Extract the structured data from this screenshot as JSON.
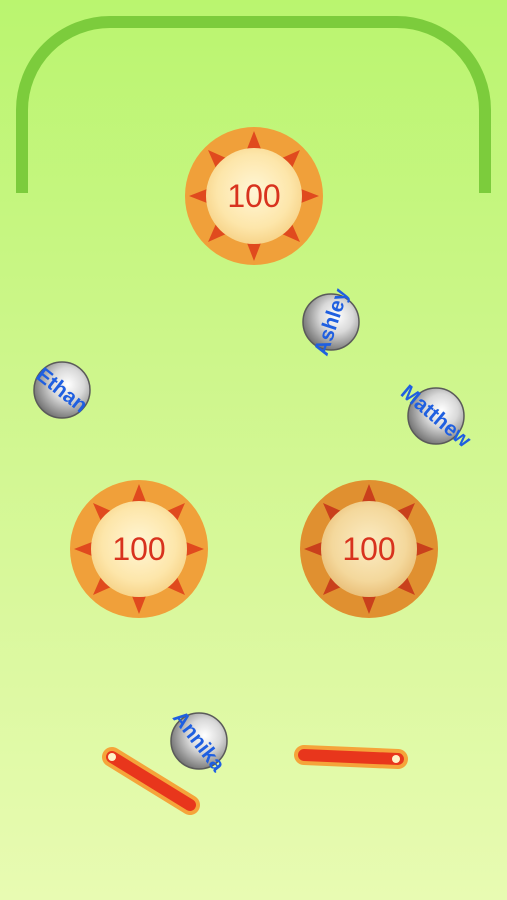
{
  "bumpers": [
    {
      "id": "top",
      "score": "100"
    },
    {
      "id": "left",
      "score": "100"
    },
    {
      "id": "right",
      "score": "100"
    }
  ],
  "balls": [
    {
      "id": "ashley",
      "name": "Ashley"
    },
    {
      "id": "ethan",
      "name": "Ethan"
    },
    {
      "id": "matthew",
      "name": "Matthew"
    },
    {
      "id": "annika",
      "name": "Annika"
    }
  ],
  "colors": {
    "rail": "#7ccc3c",
    "bumper_ring": "#f0a03a",
    "bumper_ring_dark": "#e09030",
    "bumper_spike": "#e04a1e",
    "bumper_face": "#fde8b0",
    "flipper": "#e8361c",
    "flipper_border": "#f5a43a",
    "label": "#1f5fe0"
  }
}
